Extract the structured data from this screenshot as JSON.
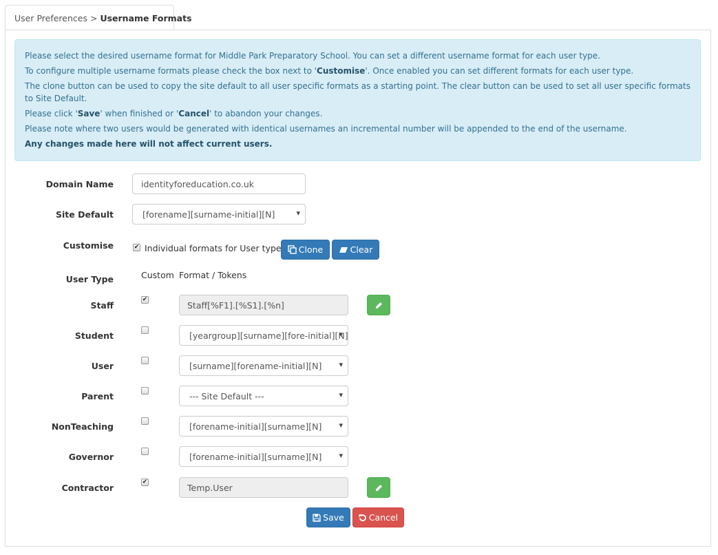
{
  "breadcrumb": {
    "parent": "User Preferences",
    "separator": ">",
    "current": "Username Formats"
  },
  "info": {
    "line1": "Please select the desired username format for Middle Park Preparatory School. You can set a different username format for each user type.",
    "line2_pre": "To configure multiple username formats please check the box next to '",
    "line2_bold": "Customise",
    "line2_post": "'. Once enabled you can set different formats for each user type.",
    "line3": "The clone button can be used to copy the site default to all user specific formats as a starting point. The clear button can be used to set all user specific formats to Site Default.",
    "line4_pre": "Please click '",
    "line4_save": "Save",
    "line4_mid": "' when finished or '",
    "line4_cancel": "Cancel",
    "line4_post": "' to abandon your changes.",
    "line5": "Please note where two users would be generated with identical usernames an incremental number will be appended to the end of the username.",
    "line6": "Any changes made here will not affect current users."
  },
  "form": {
    "domain_label": "Domain Name",
    "domain_value": "identityforeducation.co.uk",
    "site_default_label": "Site Default",
    "site_default_value": "[forename][surname-initial][N]",
    "customise_label": "Customise",
    "customise_checked": true,
    "customise_text": "Individual formats for User types",
    "clone_label": "Clone",
    "clear_label": "Clear",
    "user_type_label": "User Type",
    "custom_header": "Custom",
    "format_header": "Format / Tokens"
  },
  "user_types": [
    {
      "name": "Staff",
      "custom": true,
      "value": "Staff[%F1].[%S1].[%n]",
      "kind": "text"
    },
    {
      "name": "Student",
      "custom": false,
      "value": "[yeargroup][surname][fore-initial][N]",
      "kind": "select"
    },
    {
      "name": "User",
      "custom": false,
      "value": "[surname][forename-initial][N]",
      "kind": "select"
    },
    {
      "name": "Parent",
      "custom": false,
      "value": "--- Site Default ---",
      "kind": "select"
    },
    {
      "name": "NonTeaching",
      "custom": false,
      "value": "[forename-initial][surname][N]",
      "kind": "select"
    },
    {
      "name": "Governor",
      "custom": false,
      "value": "[forename-initial][surname][N]",
      "kind": "select"
    },
    {
      "name": "Contractor",
      "custom": true,
      "value": "Temp.User",
      "kind": "text"
    }
  ],
  "actions": {
    "save_label": "Save",
    "cancel_label": "Cancel"
  }
}
